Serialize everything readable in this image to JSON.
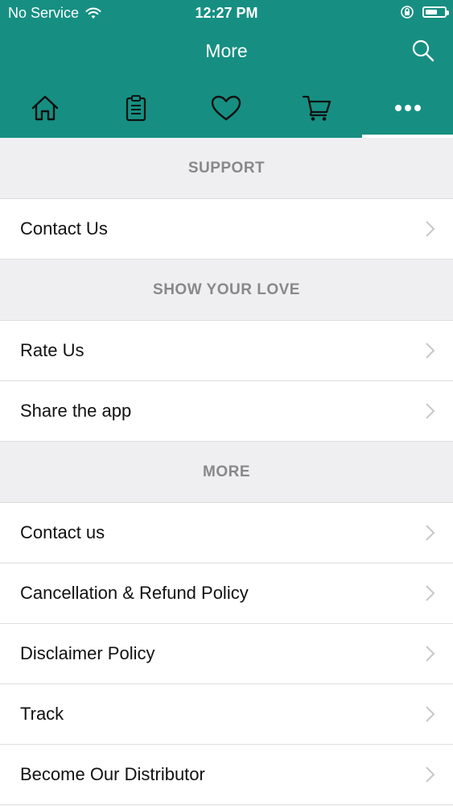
{
  "status_bar": {
    "carrier": "No Service",
    "time": "12:27 PM"
  },
  "header": {
    "title": "More"
  },
  "tabs": [
    {
      "icon": "home-icon"
    },
    {
      "icon": "clipboard-icon"
    },
    {
      "icon": "heart-icon"
    },
    {
      "icon": "cart-icon"
    },
    {
      "icon": "more-dots-icon",
      "active": true
    }
  ],
  "sections": [
    {
      "title": "SUPPORT",
      "items": [
        "Contact Us"
      ]
    },
    {
      "title": "SHOW YOUR LOVE",
      "items": [
        "Rate Us",
        "Share the app"
      ]
    },
    {
      "title": "MORE",
      "items": [
        "Contact us",
        "Cancellation & Refund Policy",
        "Disclaimer Policy",
        "Track",
        "Become Our Distributor"
      ]
    }
  ],
  "colors": {
    "brand": "#168f82",
    "section_bg": "#efeff2",
    "section_text": "#888888"
  }
}
